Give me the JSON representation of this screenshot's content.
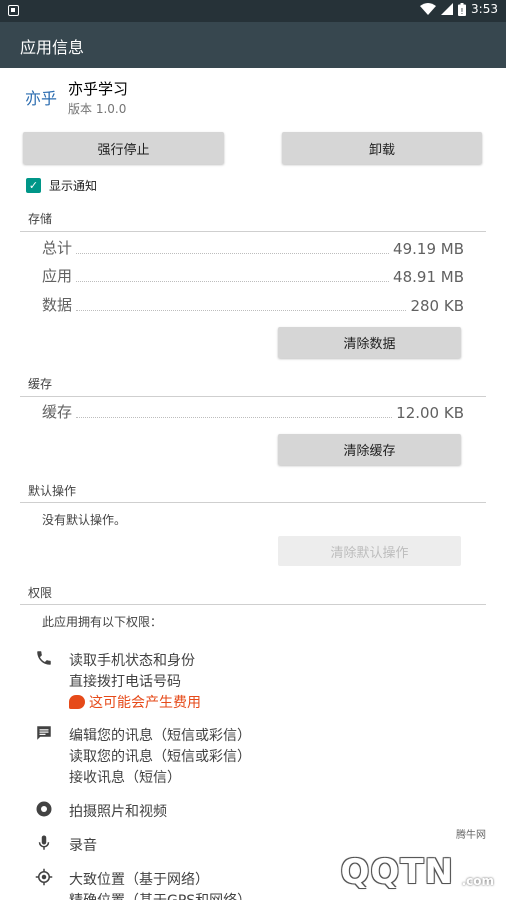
{
  "status_bar": {
    "time": "3:53"
  },
  "app_bar": {
    "title": "应用信息"
  },
  "app": {
    "icon_text": "亦乎",
    "name": "亦乎学习",
    "version": "版本 1.0.0"
  },
  "actions": {
    "force_stop": "强行停止",
    "uninstall": "卸载"
  },
  "notifications": {
    "label": "显示通知",
    "checked": true
  },
  "storage": {
    "header": "存储",
    "rows": [
      {
        "label": "总计",
        "value": "49.19 MB"
      },
      {
        "label": "应用",
        "value": "48.91 MB"
      },
      {
        "label": "数据",
        "value": "280 KB"
      }
    ],
    "clear_data": "清除数据"
  },
  "cache": {
    "header": "缓存",
    "rows": [
      {
        "label": "缓存",
        "value": "12.00 KB"
      }
    ],
    "clear_cache": "清除缓存"
  },
  "defaults": {
    "header": "默认操作",
    "text": "没有默认操作。",
    "clear_defaults": "清除默认操作"
  },
  "permissions": {
    "header": "权限",
    "intro": "此应用拥有以下权限：",
    "groups": [
      {
        "icon": "phone-icon",
        "lines": [
          "读取手机状态和身份",
          "直接拨打电话号码"
        ],
        "warning": "这可能会产生费用"
      },
      {
        "icon": "message-icon",
        "lines": [
          "编辑您的讯息（短信或彩信）",
          "读取您的讯息（短信或彩信）",
          "接收讯息（短信）"
        ]
      },
      {
        "icon": "camera-icon",
        "lines": [
          "拍摄照片和视频"
        ]
      },
      {
        "icon": "microphone-icon",
        "lines": [
          "录音"
        ]
      },
      {
        "icon": "location-icon",
        "lines": [
          "大致位置（基于网络）",
          "精确位置（基于GPS和网络）"
        ]
      }
    ]
  },
  "watermark": {
    "small": "腾牛网",
    "main": "QQTN",
    "suffix": ".com"
  },
  "colors": {
    "app_bar": "#37474f",
    "status_bar": "#263238",
    "accent": "#009688",
    "warning": "#e64a19"
  }
}
